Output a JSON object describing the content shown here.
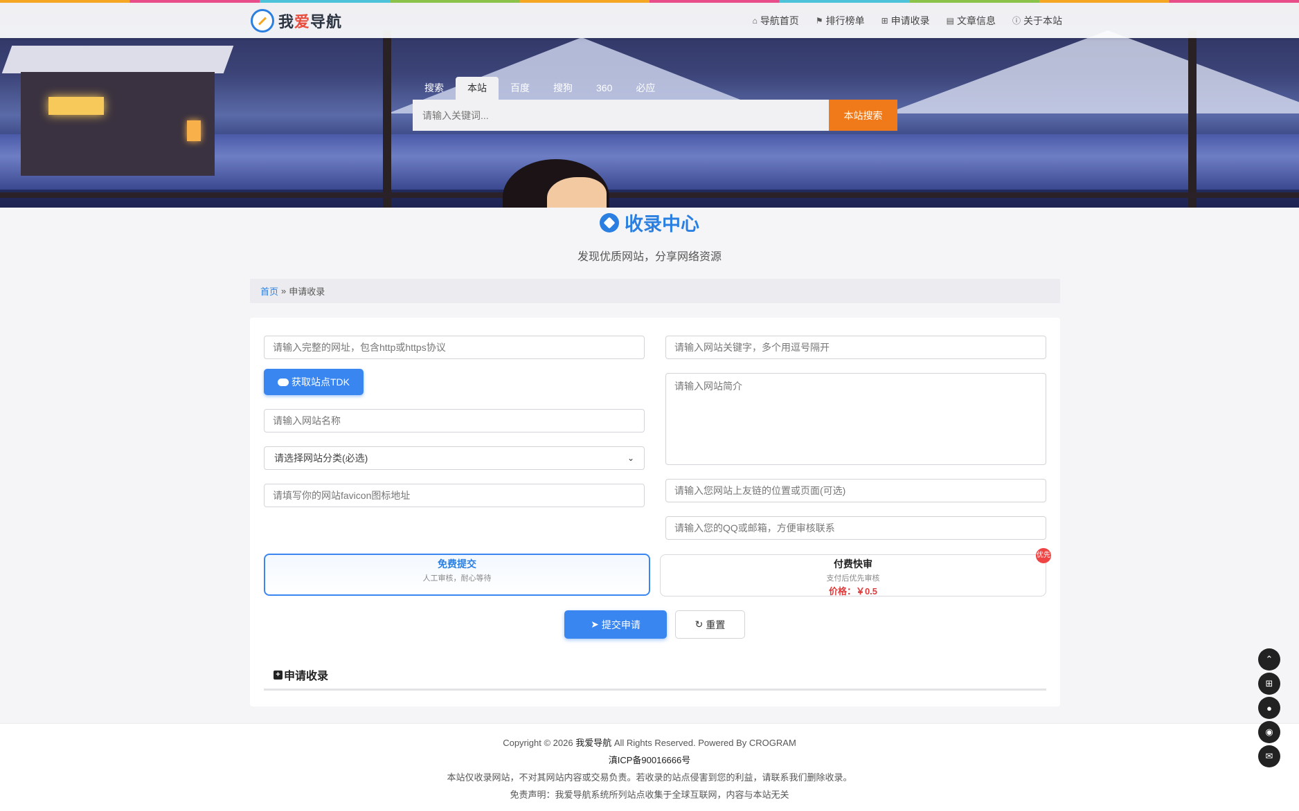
{
  "brand": {
    "name_part1": "我",
    "name_part2": "爱",
    "name_part3": "导航"
  },
  "nav": [
    {
      "icon": "home-icon",
      "glyph": "⌂",
      "label": "导航首页"
    },
    {
      "icon": "flag-icon",
      "glyph": "⚑",
      "label": "排行榜单"
    },
    {
      "icon": "plus-square-icon",
      "glyph": "⊞",
      "label": "申请收录"
    },
    {
      "icon": "book-icon",
      "glyph": "▤",
      "label": "文章信息"
    },
    {
      "icon": "info-icon",
      "glyph": "ⓘ",
      "label": "关于本站"
    }
  ],
  "search": {
    "tabs": [
      "搜索",
      "本站",
      "百度",
      "搜狗",
      "360",
      "必应"
    ],
    "active_tab": "本站",
    "placeholder": "请输入关键词...",
    "button": "本站搜索"
  },
  "page": {
    "title": "收录中心",
    "subtitle": "发现优质网站，分享网络资源"
  },
  "breadcrumb": {
    "home": "首页",
    "sep": "»",
    "current": "申请收录"
  },
  "form": {
    "url_placeholder": "请输入完整的网址，包含http或https协议",
    "tdk_button": "获取站点TDK",
    "name_placeholder": "请输入网站名称",
    "category_selected": "请选择网站分类(必选)",
    "favicon_placeholder": "请填写你的网站favicon图标地址",
    "keywords_placeholder": "请输入网站关键字，多个用逗号隔开",
    "intro_placeholder": "请输入网站简介",
    "link_placeholder": "请输入您网站上友链的位置或页面(可选)",
    "contact_placeholder": "请输入您的QQ或邮箱，方便审核联系"
  },
  "options": {
    "free": {
      "title": "免费提交",
      "desc": "人工审核，耐心等待"
    },
    "paid": {
      "title": "付费快审",
      "desc": "支付后优先审核",
      "price": "价格：￥0.5",
      "badge": "优先"
    }
  },
  "actions": {
    "submit": "提交申请",
    "reset": "重置"
  },
  "section": {
    "title": "申请收录"
  },
  "footer": {
    "copyright_a": "Copyright © 2026 ",
    "copyright_b": "我爱导航",
    "copyright_c": " All Rights Reserved. Powered By CROGRAM",
    "icp": "滇ICP备90016666号",
    "notice": "本站仅收录网站，不对其网站内容或交易负责。若收录的站点侵害到您的利益，请联系我们删除收录。",
    "disclaimer": "免责声明：我爱导航系统所列站点收集于全球互联网，内容与本站无关"
  },
  "floating": [
    "arrow-up-icon",
    "plus-square-icon",
    "qq-icon",
    "wechat-icon",
    "mail-icon"
  ],
  "colors": {
    "accent": "#2a7fe0",
    "search_button": "#f07a1a",
    "price": "#e03a3a"
  }
}
